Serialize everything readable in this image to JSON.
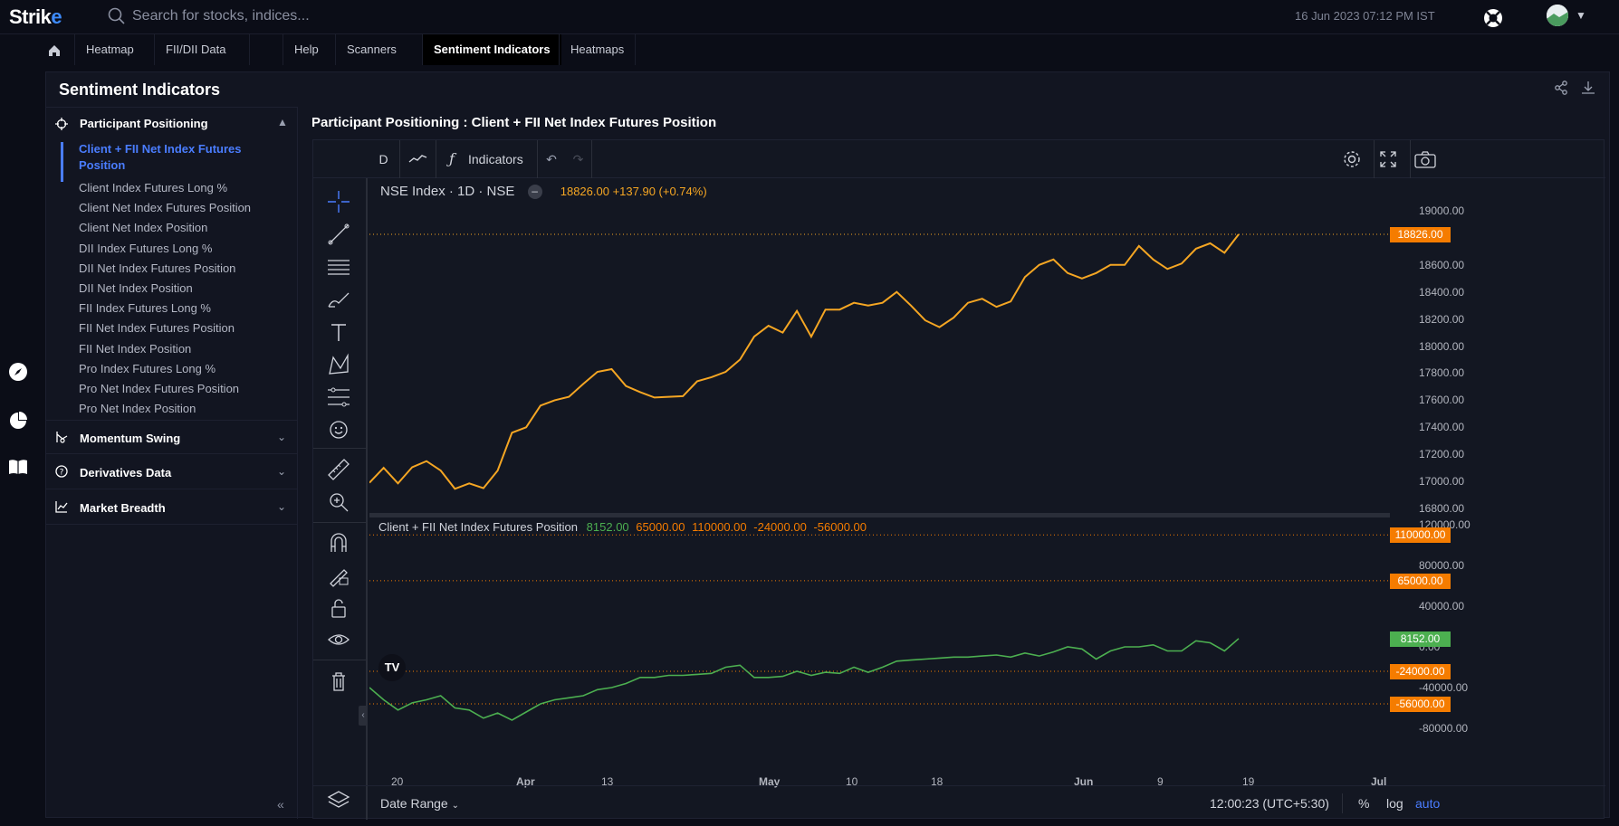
{
  "app": {
    "logo_text": "Strik",
    "logo_accent": "e",
    "timestamp": "16 Jun 2023 07:12 PM IST"
  },
  "search": {
    "placeholder": "Search for stocks, indices..."
  },
  "tabs": [
    "Heatmap",
    "FII/DII Data",
    "Help",
    "Scanners",
    "Sentiment Indicators",
    "Heatmaps"
  ],
  "panel": {
    "title": "Sentiment Indicators"
  },
  "sidebar": {
    "section1": "Participant Positioning",
    "items": [
      "Client + FII Net Index Futures Position",
      "Client Index Futures Long %",
      "Client Net Index Futures Position",
      "Client Net Index Position",
      "DII Index Futures Long %",
      "DII Net Index Futures Position",
      "DII Net Index Position",
      "FII Index Futures Long %",
      "FII Net Index Futures Position",
      "FII Net Index Position",
      "Pro Index Futures Long %",
      "Pro Net Index Futures Position",
      "Pro Net Index Position"
    ],
    "section2": "Momentum Swing",
    "section3": "Derivatives Data",
    "section4": "Market Breadth"
  },
  "chart_title": "Participant Positioning : Client + FII Net Index Futures Position",
  "toolbar": {
    "interval": "D",
    "indicators": "Indicators"
  },
  "legend": {
    "symbol": "NSE Index · 1D · NSE",
    "price": "18826.00 +137.90 (+0.74%)",
    "indicator": "Client + FII Net Index Futures Position",
    "ind_v1": "8152.00",
    "ind_v2": "65000.00",
    "ind_v3": "110000.00",
    "ind_v4": "-24000.00",
    "ind_v5": "-56000.00"
  },
  "bottom": {
    "date_range": "Date Range",
    "time": "12:00:23 (UTC+5:30)",
    "pct": "%",
    "log": "log",
    "auto": "auto"
  },
  "colors": {
    "price_line": "#f5a623",
    "indicator_line": "#4caf50",
    "accent": "#4a7dff",
    "orange_tag": "#f57c00"
  },
  "chart_data": [
    {
      "type": "line",
      "title": "NSE Index · 1D · NSE",
      "x": [
        "Mar 17",
        "Mar 20",
        "Mar 21",
        "Mar 22",
        "Mar 23",
        "Mar 24",
        "Mar 27",
        "Mar 28",
        "Mar 29",
        "Mar 31",
        "Apr 3",
        "Apr 5",
        "Apr 6",
        "Apr 10",
        "Apr 11",
        "Apr 12",
        "Apr 13",
        "Apr 17",
        "Apr 18",
        "Apr 19",
        "Apr 20",
        "Apr 21",
        "Apr 24",
        "Apr 25",
        "Apr 26",
        "Apr 27",
        "Apr 28",
        "May 2",
        "May 3",
        "May 4",
        "May 5",
        "May 8",
        "May 9",
        "May 10",
        "May 11",
        "May 12",
        "May 15",
        "May 16",
        "May 17",
        "May 18",
        "May 19",
        "May 22",
        "May 23",
        "May 24",
        "May 25",
        "May 26",
        "May 29",
        "May 30",
        "May 31",
        "Jun 1",
        "Jun 2",
        "Jun 5",
        "Jun 6",
        "Jun 7",
        "Jun 8",
        "Jun 9",
        "Jun 12",
        "Jun 13",
        "Jun 14",
        "Jun 15",
        "Jun 16"
      ],
      "values": [
        16990,
        17100,
        16985,
        17105,
        17150,
        17080,
        16945,
        16985,
        16950,
        17080,
        17360,
        17400,
        17560,
        17600,
        17625,
        17720,
        17810,
        17830,
        17705,
        17660,
        17620,
        17625,
        17630,
        17740,
        17770,
        17810,
        17900,
        18070,
        18150,
        18100,
        18260,
        18070,
        18270,
        18270,
        18320,
        18300,
        18320,
        18400,
        18300,
        18190,
        18140,
        18210,
        18320,
        18350,
        18290,
        18330,
        18510,
        18600,
        18640,
        18540,
        18500,
        18540,
        18600,
        18600,
        18740,
        18640,
        18570,
        18610,
        18720,
        18760,
        18690,
        18826
      ],
      "ylim": [
        16800,
        19000
      ],
      "yticks": [
        19000,
        18600,
        18400,
        18200,
        18000,
        17800,
        17600,
        17400,
        17200,
        17000,
        16800
      ],
      "xticks": [
        "20",
        "Apr",
        "13",
        "May",
        "10",
        "18",
        "Jun",
        "9",
        "19",
        "Jul"
      ],
      "last_value_tag": "18826.00"
    },
    {
      "type": "line",
      "title": "Client + FII Net Index Futures Position",
      "values": [
        -40000,
        -52000,
        -62000,
        -55000,
        -52000,
        -48000,
        -60000,
        -62000,
        -70000,
        -65000,
        -72000,
        -64000,
        -56000,
        -52000,
        -50000,
        -48000,
        -42000,
        -40000,
        -36000,
        -30000,
        -30000,
        -28000,
        -28000,
        -27000,
        -26000,
        -20000,
        -18000,
        -30000,
        -30000,
        -29000,
        -24000,
        -28000,
        -25000,
        -26000,
        -20000,
        -25000,
        -20000,
        -14000,
        -13000,
        -12000,
        -11000,
        -10000,
        -10000,
        -9000,
        -8000,
        -10000,
        -6000,
        -9000,
        -5000,
        0,
        -2000,
        -12000,
        -4000,
        0,
        0,
        2000,
        -4000,
        -4000,
        6000,
        4000,
        -4000,
        8152
      ],
      "ylim": [
        -80000,
        120000
      ],
      "yticks": [
        120000,
        80000,
        40000,
        0,
        -40000,
        -80000
      ],
      "level_tags": [
        {
          "label": "110000.00",
          "value": 110000,
          "color": "#f57c00"
        },
        {
          "label": "65000.00",
          "value": 65000,
          "color": "#f57c00"
        },
        {
          "label": "8152.00",
          "value": 8152,
          "color": "#4caf50"
        },
        {
          "label": "-24000.00",
          "value": -24000,
          "color": "#f57c00"
        },
        {
          "label": "-56000.00",
          "value": -56000,
          "color": "#f57c00"
        }
      ]
    }
  ]
}
